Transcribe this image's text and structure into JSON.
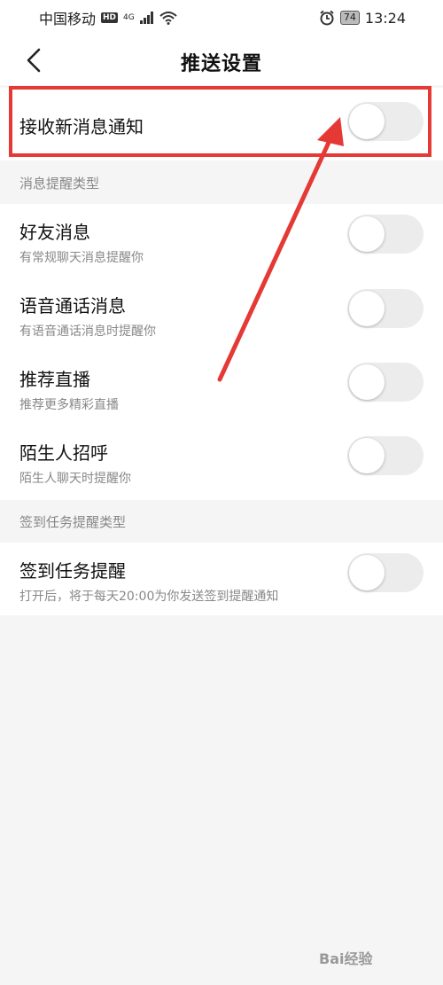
{
  "status_bar": {
    "carrier": "中国移动",
    "hd_badge": "HD",
    "network_type": "4G",
    "battery_level": "74",
    "time": "13:24"
  },
  "header": {
    "title": "推送设置",
    "back_icon": "chevron-left-icon"
  },
  "main_toggle": {
    "label": "接收新消息通知",
    "enabled": false
  },
  "sections": [
    {
      "label": "消息提醒类型",
      "items": [
        {
          "title": "好友消息",
          "subtitle": "有常规聊天消息提醒你",
          "enabled": false
        },
        {
          "title": "语音通话消息",
          "subtitle": "有语音通话消息时提醒你",
          "enabled": false
        },
        {
          "title": "推荐直播",
          "subtitle": "推荐更多精彩直播",
          "enabled": false
        },
        {
          "title": "陌生人招呼",
          "subtitle": "陌生人聊天时提醒你",
          "enabled": false
        }
      ]
    },
    {
      "label": "签到任务提醒类型",
      "items": [
        {
          "title": "签到任务提醒",
          "subtitle": "打开后，将于每天20:00为你发送签到提醒通知",
          "enabled": false
        }
      ]
    }
  ],
  "annotation": {
    "highlight_color": "#e53935"
  },
  "watermark": "Bai经验"
}
